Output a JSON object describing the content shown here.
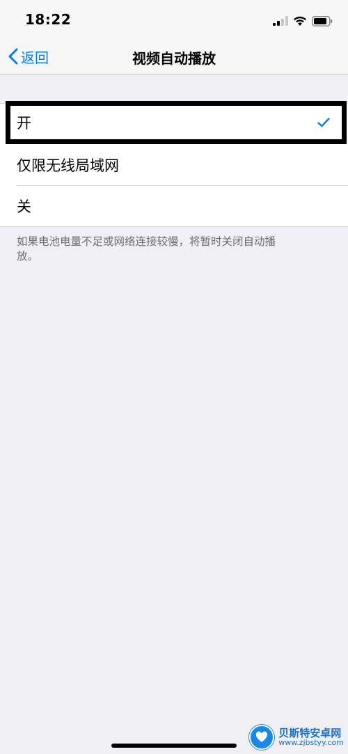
{
  "status_bar": {
    "time": "18:22",
    "icons": [
      "signal-icon",
      "wifi-icon",
      "battery-icon"
    ]
  },
  "nav": {
    "back_label": "返回",
    "title": "视频自动播放"
  },
  "options": [
    {
      "label": "开",
      "selected": true
    },
    {
      "label": "仅限无线局域网",
      "selected": false
    },
    {
      "label": "关",
      "selected": false
    }
  ],
  "footer_note": "如果电池电量不足或网络连接较慢，将暂时关闭自动播放。",
  "watermark": {
    "title": "贝斯特安卓网",
    "url": "www.zjbstyy.com"
  },
  "colors": {
    "accent": "#007aff",
    "background": "#efeff4",
    "highlight_border": "#000000"
  }
}
